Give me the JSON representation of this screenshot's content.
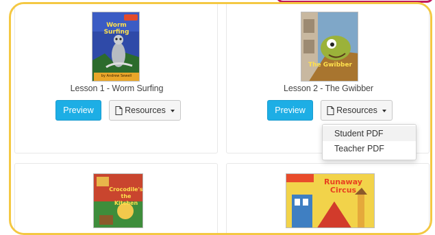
{
  "lessons": [
    {
      "title": "Lesson 1 - Worm Surfing",
      "cover_text": "Worm Surfing",
      "cover_byline": "by Andrew Sewell",
      "preview_label": "Preview",
      "resources_label": "Resources"
    },
    {
      "title": "Lesson 2 - The Gwibber",
      "cover_text": "The Gwibber",
      "preview_label": "Preview",
      "resources_label": "Resources"
    },
    {
      "cover_text": "Crocodile's the Kitchen"
    },
    {
      "cover_text": "Runaway Circus"
    }
  ],
  "resources_menu": {
    "items": [
      "Student PDF",
      "Teacher PDF"
    ]
  },
  "colors": {
    "frame_border": "#f4c842",
    "preview_button": "#1daee5",
    "accent_pink": "#c2185b"
  }
}
